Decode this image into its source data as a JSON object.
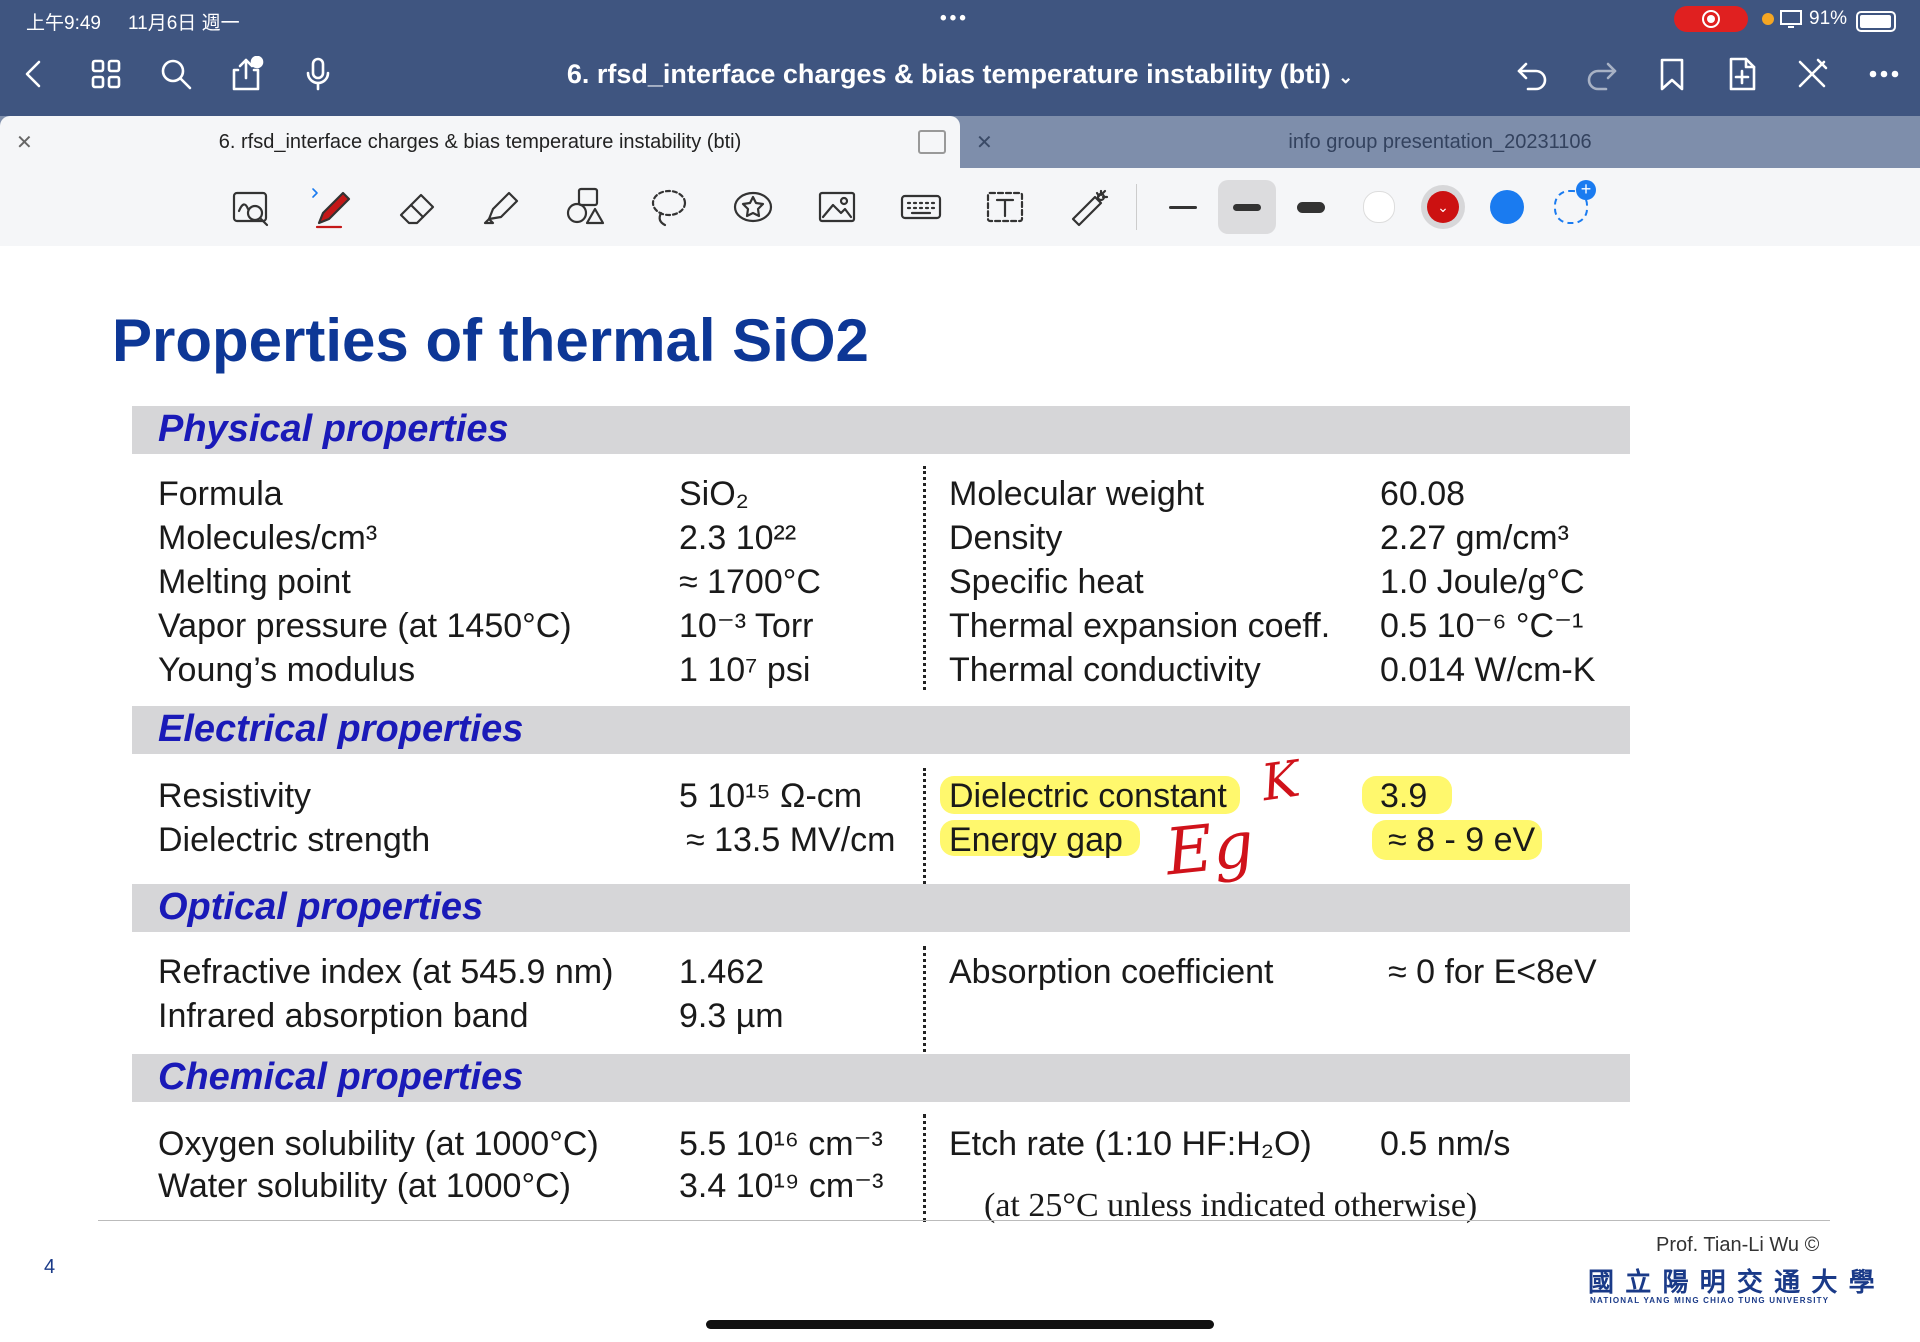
{
  "status_bar": {
    "time": "上午9:49",
    "date": "11月6日 週一",
    "battery": "91%"
  },
  "document_title": "6. rfsd_interface charges & bias temperature instability (bti)",
  "tabs": [
    {
      "label": "6. rfsd_interface charges & bias temperature instability (bti)",
      "active": true
    },
    {
      "label": "info group presentation_20231106",
      "active": false
    }
  ],
  "toolbar": {
    "tools": [
      "zoom-window-icon",
      "pen-icon",
      "eraser-icon",
      "highlighter-icon",
      "shapes-icon",
      "lasso-icon",
      "sticker-icon",
      "image-icon",
      "keyboard-icon",
      "text-icon",
      "laser-pointer-icon"
    ],
    "stroke_sizes": [
      "thin",
      "medium",
      "thick"
    ],
    "colors": [
      "#ffffff",
      "#cc1111",
      "#1a7bf0"
    ],
    "selected_color": "#cc1111"
  },
  "slide": {
    "title": "Properties of thermal SiO2",
    "sections": [
      {
        "name": "Physical properties",
        "left": [
          {
            "label": "Formula",
            "value": "SiO₂"
          },
          {
            "label": "Molecules/cm³",
            "value": "2.3 10²²"
          },
          {
            "label": "Melting point",
            "value": "≈ 1700°C"
          },
          {
            "label": "Vapor pressure (at 1450°C)",
            "value": "10⁻³ Torr"
          },
          {
            "label": "Young’s modulus",
            "value": "1 10⁷ psi"
          }
        ],
        "right": [
          {
            "label": "Molecular weight",
            "value": "60.08"
          },
          {
            "label": "Density",
            "value": "2.27 gm/cm³"
          },
          {
            "label": "Specific heat",
            "value": "1.0 Joule/g°C"
          },
          {
            "label": "Thermal expansion coeff.",
            "value": "0.5 10⁻⁶ °C⁻¹"
          },
          {
            "label": "Thermal conductivity",
            "value": "0.014 W/cm-K"
          }
        ]
      },
      {
        "name": "Electrical properties",
        "left": [
          {
            "label": "Resistivity",
            "value": "5 10¹⁵ Ω-cm"
          },
          {
            "label": "Dielectric strength",
            "value": "≈ 13.5 MV/cm"
          }
        ],
        "right": [
          {
            "label": "Dielectric constant",
            "value": "3.9"
          },
          {
            "label": "Energy gap",
            "value": "≈ 8 - 9 eV"
          }
        ]
      },
      {
        "name": "Optical properties",
        "left": [
          {
            "label": "Refractive index (at 545.9 nm)",
            "value": "1.462"
          },
          {
            "label": "Infrared absorption band",
            "value": "9.3 µm"
          }
        ],
        "right": [
          {
            "label": "Absorption coefficient",
            "value": "≈ 0 for E<8eV"
          }
        ]
      },
      {
        "name": "Chemical properties",
        "left": [
          {
            "label": "Oxygen solubility (at 1000°C)",
            "value": "5.5 10¹⁶ cm⁻³"
          },
          {
            "label": "Water solubility (at 1000°C)",
            "value": "3.4 10¹⁹ cm⁻³"
          }
        ],
        "right": [
          {
            "label": "Etch rate (1:10 HF:H₂O)",
            "value": "0.5 nm/s"
          }
        ]
      }
    ],
    "footnote": "(at 25°C unless indicated otherwise)",
    "page_number": "4",
    "credit": "Prof. Tian-Li Wu ©",
    "university_cn": "國 立 陽 明 交 通 大 學",
    "university_en": "NATIONAL YANG MING CHIAO TUNG UNIVERSITY",
    "handwriting": {
      "k": "K",
      "eg": "Eg"
    }
  }
}
